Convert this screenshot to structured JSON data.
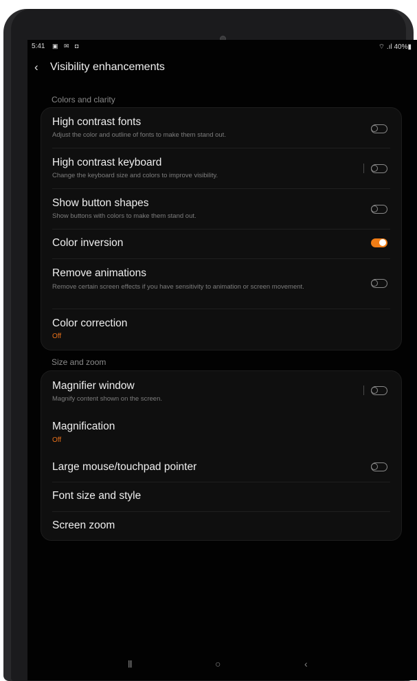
{
  "status_bar": {
    "time": "5:41",
    "notif_icons": "▣ ✉ ◘",
    "right": "⌔ .ıl 40%▮"
  },
  "header": {
    "back_icon": "‹",
    "title": "Visibility enhancements"
  },
  "sections": {
    "colors": "Colors and clarity",
    "size": "Size and zoom"
  },
  "colors_items": [
    {
      "label": "High contrast fonts",
      "sub": "Adjust the color and outline of fonts to make them stand out.",
      "toggle": false
    },
    {
      "label": "High contrast keyboard",
      "sub": "Change the keyboard size and colors to improve visibility.",
      "toggle": false
    },
    {
      "label": "Show button shapes",
      "sub": "Show buttons with colors to make them stand out.",
      "toggle": false
    },
    {
      "label": "Color inversion",
      "toggle": true
    },
    {
      "label": "Remove animations",
      "sub": "Remove certain screen effects if you have sensitivity to animation or screen movement.",
      "toggle": false
    },
    {
      "label": "Color correction",
      "status": "Off"
    }
  ],
  "size_items": [
    {
      "label": "Magnifier window",
      "sub": "Magnify content shown on the screen.",
      "toggle": false
    },
    {
      "label": "Magnification",
      "status": "Off"
    },
    {
      "label": "Large mouse/touchpad pointer",
      "toggle": false
    },
    {
      "label": "Font size and style"
    },
    {
      "label": "Screen zoom"
    }
  ],
  "nav": {
    "recents": "|||",
    "home": "○",
    "back": "‹"
  },
  "colors_accent": {
    "accent": "#f07d16",
    "background": "#020202",
    "card": "#0f0f0f"
  }
}
